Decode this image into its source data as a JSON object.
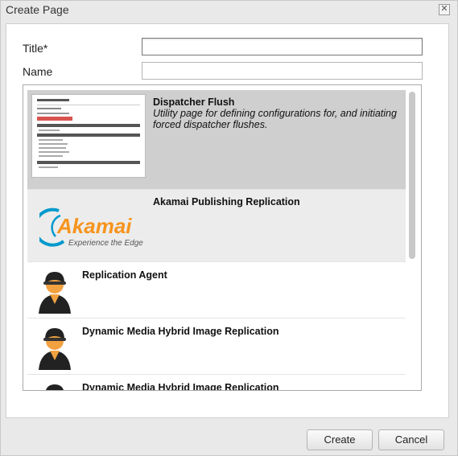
{
  "dialog": {
    "title": "Create Page",
    "close_symbol": "✕"
  },
  "form": {
    "title_label": "Title*",
    "title_value": "",
    "name_label": "Name",
    "name_value": ""
  },
  "templates": [
    {
      "name": "Dispatcher Flush",
      "description": "Utility page for defining configurations for, and initiating forced dispatcher flushes.",
      "thumbnail": "dispatcher-flush-screenshot",
      "selected": true
    },
    {
      "name": "Akamai Publishing Replication",
      "description": "",
      "thumbnail": "akamai-logo",
      "logo_text": "Akamai",
      "logo_tagline": "Experience the Edge"
    },
    {
      "name": "Replication Agent",
      "description": "",
      "thumbnail": "agent-icon"
    },
    {
      "name": "Dynamic Media Hybrid Image Replication",
      "description": "",
      "thumbnail": "agent-icon"
    },
    {
      "name": "Dynamic Media Hybrid Image Replication",
      "description": "",
      "thumbnail": "agent-icon"
    }
  ],
  "buttons": {
    "create": "Create",
    "cancel": "Cancel"
  },
  "colors": {
    "akamai_blue": "#0099cc",
    "akamai_orange": "#f7941d",
    "selected_row": "#cfcfcf"
  }
}
